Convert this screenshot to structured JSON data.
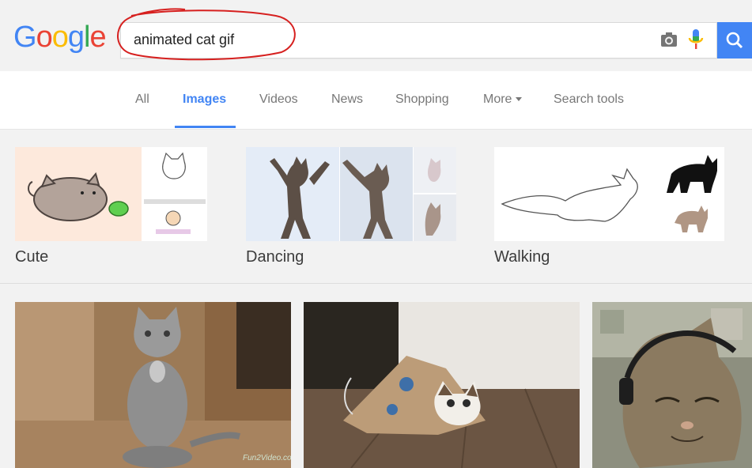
{
  "header": {
    "logo": [
      "G",
      "o",
      "o",
      "g",
      "l",
      "e"
    ],
    "logo_colors": [
      "#4285f4",
      "#ea4335",
      "#fbbc05",
      "#4285f4",
      "#34a853",
      "#ea4335"
    ],
    "search_query": "animated cat gif"
  },
  "tabs": [
    {
      "label": "All",
      "active": false
    },
    {
      "label": "Images",
      "active": true
    },
    {
      "label": "Videos",
      "active": false
    },
    {
      "label": "News",
      "active": false
    },
    {
      "label": "Shopping",
      "active": false
    },
    {
      "label": "More",
      "active": false
    },
    {
      "label": "Search tools",
      "active": false
    }
  ],
  "related_searches": [
    {
      "label": "Cute"
    },
    {
      "label": "Dancing"
    },
    {
      "label": "Walking"
    }
  ],
  "image_results": [
    {
      "description": "gray cat standing on hind legs",
      "watermark": "Fun2Video.co"
    },
    {
      "description": "cat inside a paper bag on wood floor"
    },
    {
      "description": "tabby cat wearing headphones"
    }
  ],
  "colors": {
    "accent": "#4285f4",
    "annotation": "#d6201f"
  }
}
